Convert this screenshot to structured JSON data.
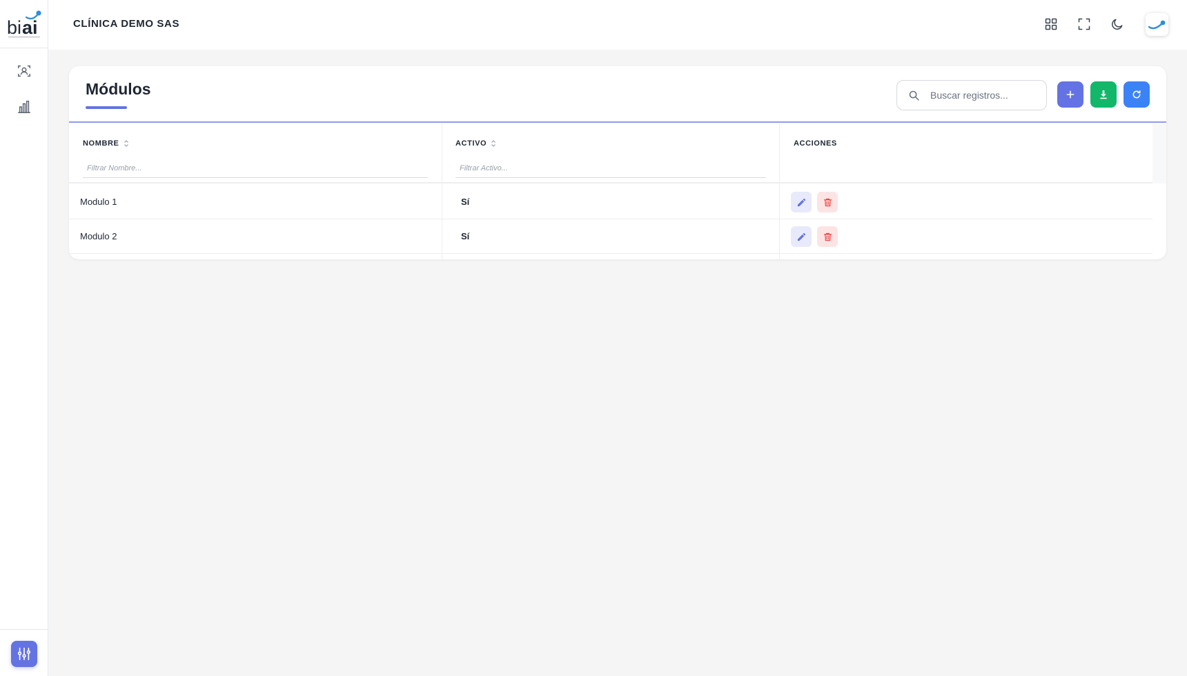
{
  "app": {
    "logo_text": "biai",
    "company": "CLÍNICA DEMO SAS"
  },
  "sidebar": {
    "items": [
      {
        "icon": "user-scan-icon"
      },
      {
        "icon": "bar-chart-icon"
      }
    ],
    "bottom_icon": "sliders-icon"
  },
  "topbar": {
    "icons": [
      "grid-icon",
      "fullscreen-icon",
      "moon-icon"
    ],
    "avatar_icon": "brand-swoosh-icon"
  },
  "page": {
    "title": "Módulos",
    "search_placeholder": "Buscar registros...",
    "actions": [
      "add-icon",
      "download-icon",
      "refresh-icon"
    ]
  },
  "table": {
    "columns": [
      {
        "label": "NOMBRE",
        "filter_placeholder": "Filtrar Nombre...",
        "sortable": true
      },
      {
        "label": "ACTIVO",
        "filter_placeholder": "Filtrar Activo...",
        "sortable": true
      },
      {
        "label": "ACCIONES",
        "sortable": false
      }
    ],
    "rows": [
      {
        "nombre": "Modulo 1",
        "activo": "Sí"
      },
      {
        "nombre": "Modulo 2",
        "activo": "Sí"
      }
    ]
  },
  "colors": {
    "primary": "#6473e3",
    "success": "#12b76a",
    "info": "#3b82f6",
    "danger": "#ef4444",
    "brand_blue": "#2f8fd8"
  }
}
